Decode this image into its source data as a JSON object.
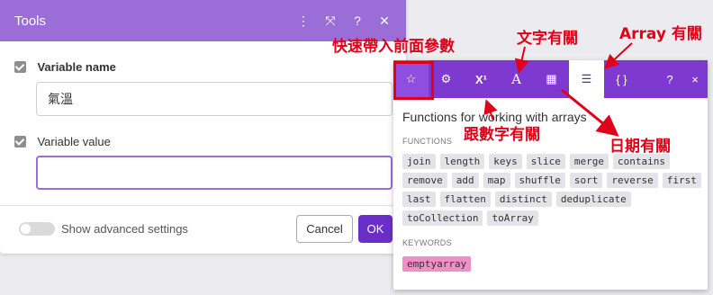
{
  "tools": {
    "title": "Tools",
    "icons": [
      "more-vertical-icon",
      "expand-icon",
      "help-icon",
      "close-icon"
    ],
    "variable_name_label": "Variable name",
    "variable_name_value": "氣溫",
    "variable_value_label": "Variable value",
    "variable_value_value": "",
    "advanced_label": "Show advanced settings",
    "cancel_label": "Cancel",
    "ok_label": "OK"
  },
  "panel": {
    "tabs": [
      "star-icon",
      "gear-icon",
      "superscript-icon",
      "text-icon",
      "calendar-icon",
      "array-icon",
      "braces-icon"
    ],
    "selected_tab": "array-icon",
    "help": "?",
    "close": "×",
    "title": "Functions for working with arrays",
    "functions_heading": "FUNCTIONS",
    "functions": [
      "join",
      "length",
      "keys",
      "slice",
      "merge",
      "contains",
      "remove",
      "add",
      "map",
      "shuffle",
      "sort",
      "reverse",
      "first",
      "last",
      "flatten",
      "distinct",
      "deduplicate",
      "toCollection",
      "toArray"
    ],
    "keywords_heading": "KEYWORDS",
    "keywords": [
      "emptyarray"
    ],
    "accent_color": "#7e3ad0"
  },
  "annotations": {
    "favorites": "快速帶入前面參數",
    "text": "文字有關",
    "array": "Array 有關",
    "math": "跟數字有關",
    "date": "日期有關",
    "color": "#e0001a"
  }
}
